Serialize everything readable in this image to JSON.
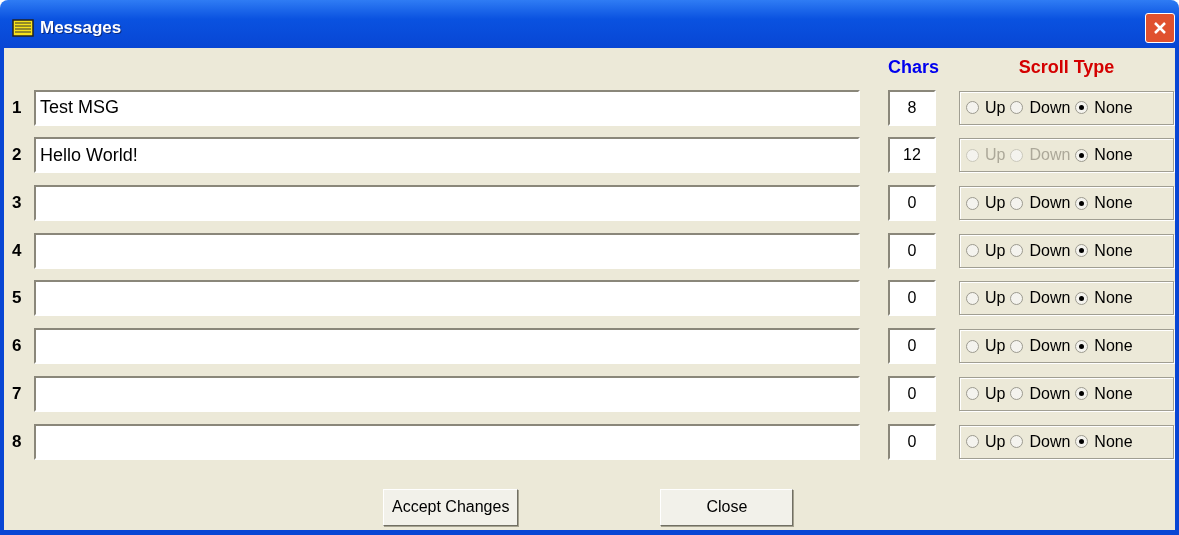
{
  "window": {
    "title": "Messages"
  },
  "headers": {
    "chars": "Chars",
    "scroll_type": "Scroll Type"
  },
  "rows": [
    {
      "number": "1",
      "text": "Test MSG",
      "chars": "8",
      "options": [
        {
          "label": "Up",
          "selected": false,
          "disabled": false
        },
        {
          "label": "Down",
          "selected": false,
          "disabled": false
        },
        {
          "label": "None",
          "selected": true,
          "disabled": false
        }
      ]
    },
    {
      "number": "2",
      "text": "Hello World!",
      "chars": "12",
      "options": [
        {
          "label": "Up",
          "selected": false,
          "disabled": true
        },
        {
          "label": "Down",
          "selected": false,
          "disabled": true
        },
        {
          "label": "None",
          "selected": true,
          "disabled": false
        }
      ]
    },
    {
      "number": "3",
      "text": "",
      "chars": "0",
      "options": [
        {
          "label": "Up",
          "selected": false,
          "disabled": false
        },
        {
          "label": "Down",
          "selected": false,
          "disabled": false
        },
        {
          "label": "None",
          "selected": true,
          "disabled": false
        }
      ]
    },
    {
      "number": "4",
      "text": "",
      "chars": "0",
      "options": [
        {
          "label": "Up",
          "selected": false,
          "disabled": false
        },
        {
          "label": "Down",
          "selected": false,
          "disabled": false
        },
        {
          "label": "None",
          "selected": true,
          "disabled": false
        }
      ]
    },
    {
      "number": "5",
      "text": "",
      "chars": "0",
      "options": [
        {
          "label": "Up",
          "selected": false,
          "disabled": false
        },
        {
          "label": "Down",
          "selected": false,
          "disabled": false
        },
        {
          "label": "None",
          "selected": true,
          "disabled": false
        }
      ]
    },
    {
      "number": "6",
      "text": "",
      "chars": "0",
      "options": [
        {
          "label": "Up",
          "selected": false,
          "disabled": false
        },
        {
          "label": "Down",
          "selected": false,
          "disabled": false
        },
        {
          "label": "None",
          "selected": true,
          "disabled": false
        }
      ]
    },
    {
      "number": "7",
      "text": "",
      "chars": "0",
      "options": [
        {
          "label": "Up",
          "selected": false,
          "disabled": false
        },
        {
          "label": "Down",
          "selected": false,
          "disabled": false
        },
        {
          "label": "None",
          "selected": true,
          "disabled": false
        }
      ]
    },
    {
      "number": "8",
      "text": "",
      "chars": "0",
      "options": [
        {
          "label": "Up",
          "selected": false,
          "disabled": false
        },
        {
          "label": "Down",
          "selected": false,
          "disabled": false
        },
        {
          "label": "None",
          "selected": true,
          "disabled": false
        }
      ]
    }
  ],
  "buttons": [
    "Accept Changes",
    "Close"
  ]
}
